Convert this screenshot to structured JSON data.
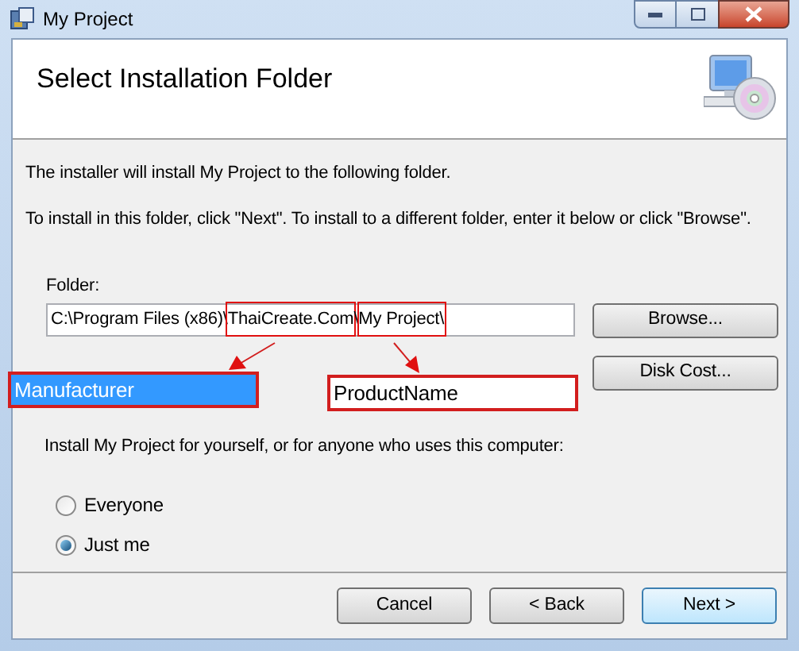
{
  "window": {
    "title": "My Project"
  },
  "header": {
    "title": "Select Installation Folder"
  },
  "intro": [
    "The installer will install My Project to the following folder.",
    "To install in this folder, click \"Next\". To install to a different folder, enter it below or click \"Browse\"."
  ],
  "folder": {
    "label": "Folder:",
    "value_parts": [
      {
        "text": "C:\\Program Files (x86)\\",
        "marked": false
      },
      {
        "text": "ThaiCreate.Com",
        "marked": true
      },
      {
        "text": "\\",
        "marked": false
      },
      {
        "text": "My Project\\",
        "marked": true
      }
    ]
  },
  "side_buttons": [
    "Browse...",
    "Disk Cost..."
  ],
  "annotations": [
    {
      "label": "Manufacturer",
      "selected": true
    },
    {
      "label": "ProductName",
      "selected": false
    }
  ],
  "scope": {
    "prompt": "Install My Project for yourself, or for anyone who uses this computer:",
    "options": [
      {
        "label": "Everyone",
        "selected": false
      },
      {
        "label": "Just me",
        "selected": true
      }
    ]
  },
  "buttons": [
    {
      "label": "Cancel",
      "default": false
    },
    {
      "label": "< Back",
      "default": false
    },
    {
      "label": "Next >",
      "default": true
    }
  ]
}
